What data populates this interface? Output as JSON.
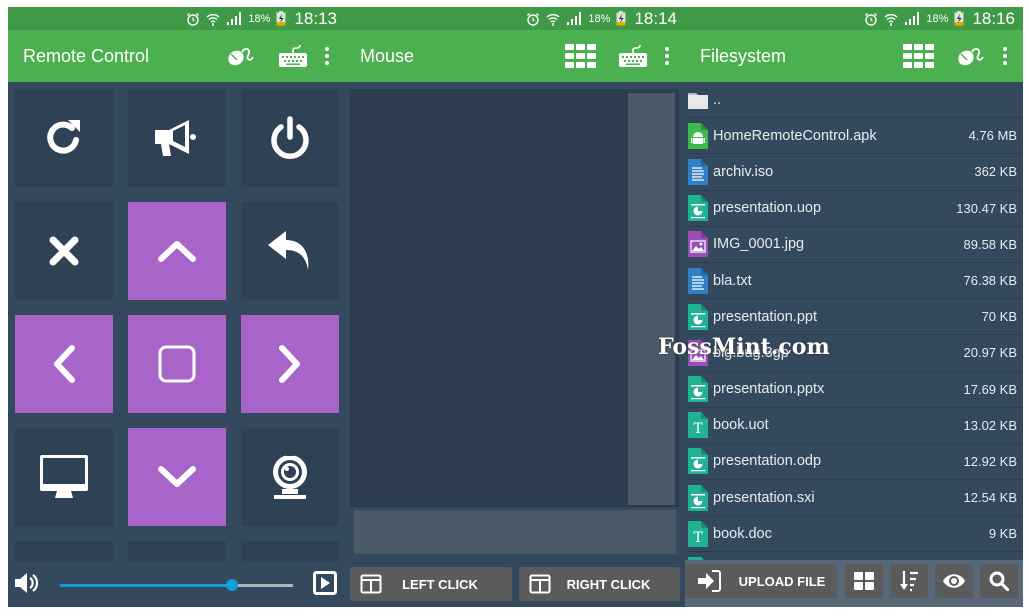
{
  "status_icons": [
    "alarm-icon",
    "wifi-icon",
    "signal-icon",
    "battery-charging-icon"
  ],
  "screens": [
    {
      "status": {
        "battery": "18%",
        "time": "18:13"
      },
      "title": "Remote Control",
      "actions": [
        "mouse-icon",
        "keyboard-icon",
        "more-vert-icon"
      ],
      "tiles": [
        {
          "icon": "refresh-icon",
          "color": "dark"
        },
        {
          "icon": "megaphone-icon",
          "color": "dark"
        },
        {
          "icon": "power-icon",
          "color": "dark"
        },
        {
          "icon": "close-icon",
          "color": "dark"
        },
        {
          "icon": "chevron-up-icon",
          "color": "purple"
        },
        {
          "icon": "back-icon",
          "color": "dark"
        },
        {
          "icon": "chevron-left-icon",
          "color": "purple"
        },
        {
          "icon": "ok-square-icon",
          "color": "purple"
        },
        {
          "icon": "chevron-right-icon",
          "color": "purple"
        },
        {
          "icon": "monitor-icon",
          "color": "dark"
        },
        {
          "icon": "chevron-down-icon",
          "color": "purple"
        },
        {
          "icon": "webcam-icon",
          "color": "dark"
        }
      ],
      "volume": {
        "icon": "volume-icon",
        "value": 0.74,
        "play_icon": "play-icon"
      }
    },
    {
      "status": {
        "battery": "18%",
        "time": "18:14"
      },
      "title": "Mouse",
      "actions": [
        "grid-icon",
        "keyboard-icon",
        "more-vert-icon"
      ],
      "left_click": "LEFT CLICK",
      "right_click": "RIGHT CLICK"
    },
    {
      "status": {
        "battery": "18%",
        "time": "18:16"
      },
      "title": "Filesystem",
      "actions": [
        "grid-icon",
        "mouse-icon",
        "more-vert-icon"
      ],
      "files": [
        {
          "name": "..",
          "size": "",
          "type": "folder"
        },
        {
          "name": "HomeRemoteControl.apk",
          "size": "4.76 MB",
          "type": "apk"
        },
        {
          "name": "archiv.iso",
          "size": "362 KB",
          "type": "text"
        },
        {
          "name": "presentation.uop",
          "size": "130.47 KB",
          "type": "presentation"
        },
        {
          "name": "IMG_0001.jpg",
          "size": "89.58 KB",
          "type": "image"
        },
        {
          "name": "bla.txt",
          "size": "76.38 KB",
          "type": "text"
        },
        {
          "name": "presentation.ppt",
          "size": "70 KB",
          "type": "presentation"
        },
        {
          "name": "big.bug.3gp",
          "size": "20.97 KB",
          "type": "image"
        },
        {
          "name": "presentation.pptx",
          "size": "17.69 KB",
          "type": "presentation"
        },
        {
          "name": "book.uot",
          "size": "13.02 KB",
          "type": "document"
        },
        {
          "name": "presentation.odp",
          "size": "12.92 KB",
          "type": "presentation"
        },
        {
          "name": "presentation.sxi",
          "size": "12.54 KB",
          "type": "presentation"
        },
        {
          "name": "book.doc",
          "size": "9 KB",
          "type": "document"
        }
      ],
      "toolbar": {
        "upload_label": "UPLOAD FILE",
        "buttons": [
          "view-grid-icon",
          "sort-icon",
          "eye-icon",
          "search-icon"
        ]
      }
    }
  ],
  "colors": {
    "appbar": "#4caf50",
    "statusbar": "#3e9a46",
    "background": "#34495e",
    "tile": "#2e4155",
    "accent_purple": "#a864c8",
    "slider": "#0ea0d8",
    "file_apk": "#3dba4e",
    "file_text": "#2f80c4",
    "file_presentation": "#1fb394",
    "file_image": "#9a4fb6"
  },
  "watermark": "FossMint.com"
}
